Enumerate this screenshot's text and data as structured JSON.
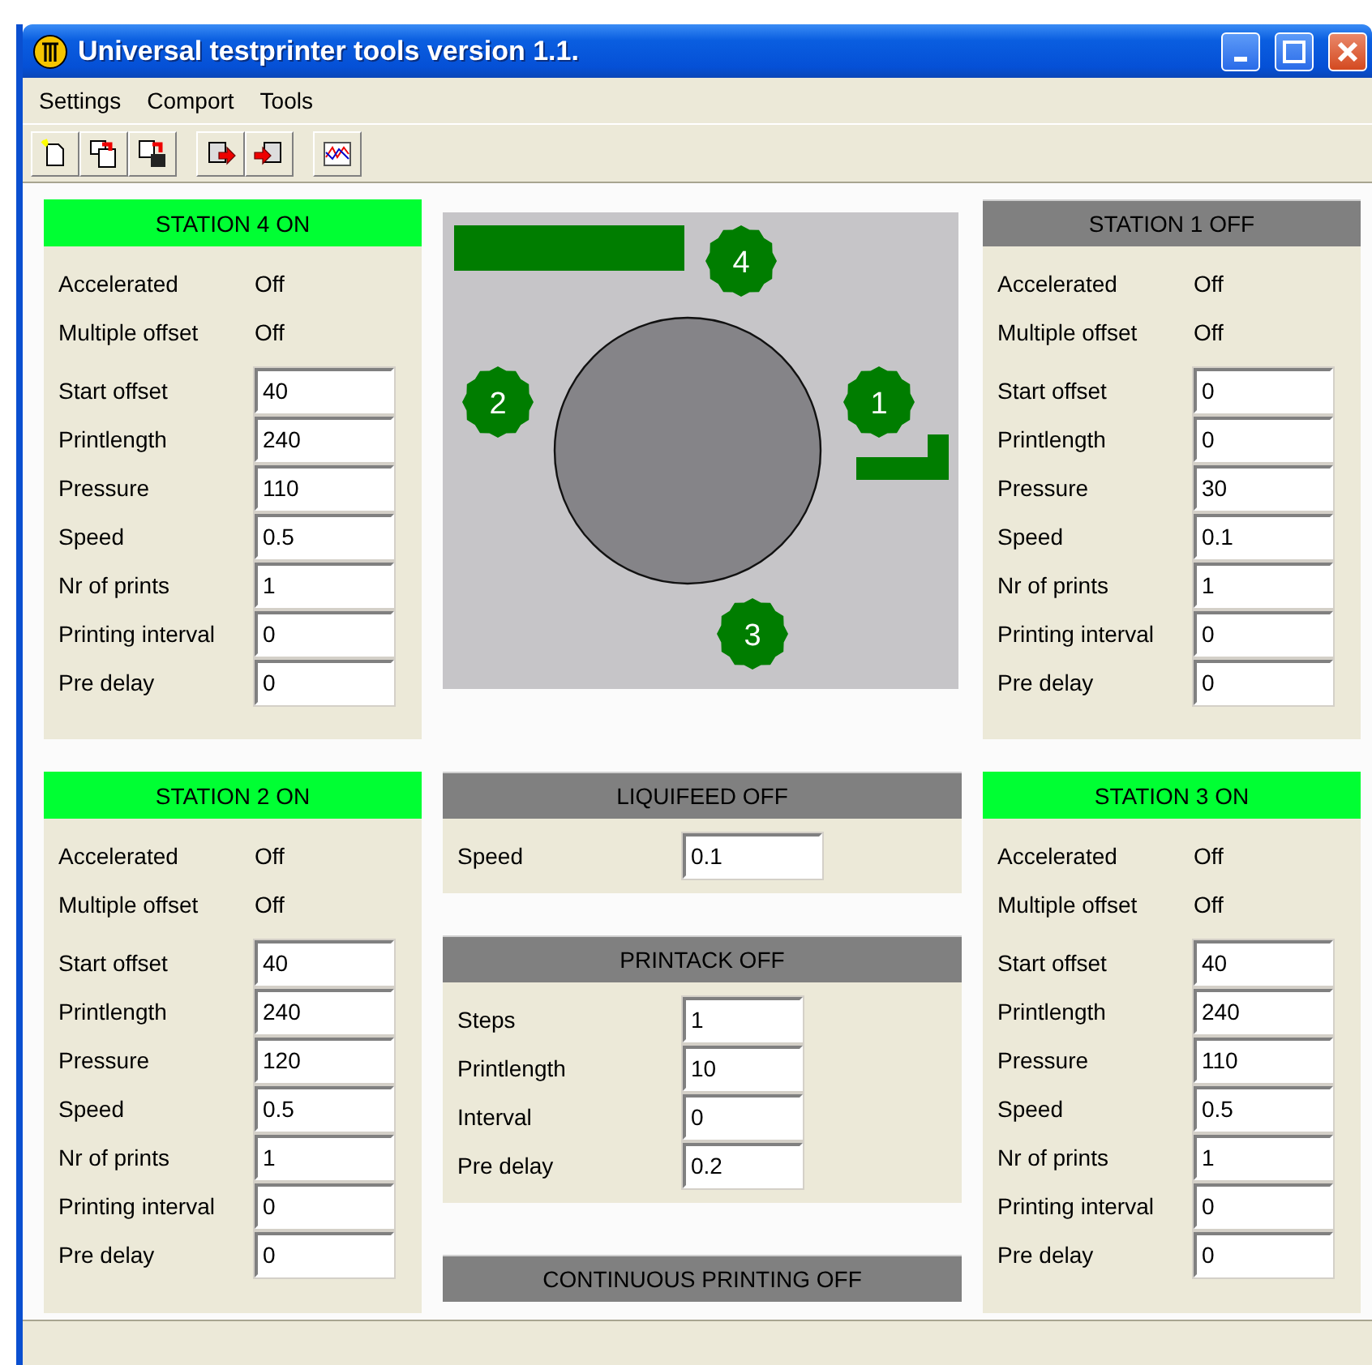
{
  "window": {
    "title": "Universal testprinter tools version 1.1."
  },
  "menu": [
    {
      "label": "Settings"
    },
    {
      "label": "Comport"
    },
    {
      "label": "Tools"
    }
  ],
  "stations": [
    {
      "title": "STATION 4 ON",
      "on": true,
      "settings": [
        {
          "label": "Accelerated",
          "value": "Off"
        },
        {
          "label": "Multiple offset",
          "value": "Off"
        }
      ],
      "fields": [
        {
          "label": "Start offset",
          "value": "40"
        },
        {
          "label": "Printlength",
          "value": "240"
        },
        {
          "label": "Pressure",
          "value": "110"
        },
        {
          "label": "Speed",
          "value": "0.5"
        },
        {
          "label": "Nr of prints",
          "value": "1"
        },
        {
          "label": "Printing interval",
          "value": "0"
        },
        {
          "label": "Pre delay",
          "value": "0"
        }
      ]
    },
    {
      "title": "STATION 1 OFF",
      "on": false,
      "settings": [
        {
          "label": "Accelerated",
          "value": "Off"
        },
        {
          "label": "Multiple offset",
          "value": "Off"
        }
      ],
      "fields": [
        {
          "label": "Start offset",
          "value": "0"
        },
        {
          "label": "Printlength",
          "value": "0"
        },
        {
          "label": "Pressure",
          "value": "30"
        },
        {
          "label": "Speed",
          "value": "0.1"
        },
        {
          "label": "Nr of prints",
          "value": "1"
        },
        {
          "label": "Printing interval",
          "value": "0"
        },
        {
          "label": "Pre delay",
          "value": "0"
        }
      ]
    },
    {
      "title": "STATION 2 ON",
      "on": true,
      "settings": [
        {
          "label": "Accelerated",
          "value": "Off"
        },
        {
          "label": "Multiple offset",
          "value": "Off"
        }
      ],
      "fields": [
        {
          "label": "Start offset",
          "value": "40"
        },
        {
          "label": "Printlength",
          "value": "240"
        },
        {
          "label": "Pressure",
          "value": "120"
        },
        {
          "label": "Speed",
          "value": "0.5"
        },
        {
          "label": "Nr of prints",
          "value": "1"
        },
        {
          "label": "Printing interval",
          "value": "0"
        },
        {
          "label": "Pre delay",
          "value": "0"
        }
      ]
    },
    {
      "title": "STATION 3 ON",
      "on": true,
      "settings": [
        {
          "label": "Accelerated",
          "value": "Off"
        },
        {
          "label": "Multiple offset",
          "value": "Off"
        }
      ],
      "fields": [
        {
          "label": "Start offset",
          "value": "40"
        },
        {
          "label": "Printlength",
          "value": "240"
        },
        {
          "label": "Pressure",
          "value": "110"
        },
        {
          "label": "Speed",
          "value": "0.5"
        },
        {
          "label": "Nr of prints",
          "value": "1"
        },
        {
          "label": "Printing interval",
          "value": "0"
        },
        {
          "label": "Pre delay",
          "value": "0"
        }
      ]
    }
  ],
  "diagram": {
    "markers": [
      {
        "label": "4"
      },
      {
        "label": "2"
      },
      {
        "label": "1"
      },
      {
        "label": "3"
      }
    ]
  },
  "liquifeed": {
    "title": "LIQUIFEED OFF",
    "on": false,
    "fields": [
      {
        "label": "Speed",
        "value": "0.1"
      }
    ]
  },
  "printack": {
    "title": "PRINTACK OFF",
    "on": false,
    "fields": [
      {
        "label": "Steps",
        "value": "1"
      },
      {
        "label": "Printlength",
        "value": "10"
      },
      {
        "label": "Interval",
        "value": "0"
      },
      {
        "label": "Pre delay",
        "value": "0.2"
      }
    ]
  },
  "continuous": {
    "title": "CONTINUOUS PRINTING OFF",
    "on": false
  }
}
